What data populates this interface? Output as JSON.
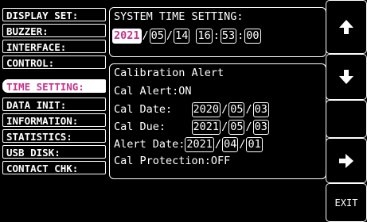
{
  "menu": [
    {
      "label": "DISPLAY SET:"
    },
    {
      "label": "BUZZER:"
    },
    {
      "label": "INTERFACE:"
    },
    {
      "label": "CONTROL:"
    },
    {
      "label": "TIME SETTING:"
    },
    {
      "label": "DATA INIT:"
    },
    {
      "label": "INFORMATION:"
    },
    {
      "label": "STATISTICS:"
    },
    {
      "label": "USB DISK:"
    },
    {
      "label": "CONTACT CHK:"
    }
  ],
  "system_time": {
    "title": "SYSTEM TIME SETTING:",
    "year": "2021",
    "month": "05",
    "day": "14",
    "hour": "16",
    "minute": "53",
    "second": "00"
  },
  "calibration": {
    "title": "Calibration Alert",
    "alert_label": "Cal Alert:",
    "alert_value": "ON",
    "date_label": "Cal Date:",
    "date_year": "2020",
    "date_month": "05",
    "date_day": "03",
    "due_label": "Cal Due:",
    "due_year": "2021",
    "due_month": "05",
    "due_day": "03",
    "alertdate_label": "Alert Date:",
    "alertdate_year": "2021",
    "alertdate_month": "04",
    "alertdate_day": "01",
    "protection_label": "Cal Protection:",
    "protection_value": "OFF"
  },
  "buttons": {
    "exit_label": "EXIT"
  },
  "separators": {
    "date": "/",
    "time": ":"
  }
}
